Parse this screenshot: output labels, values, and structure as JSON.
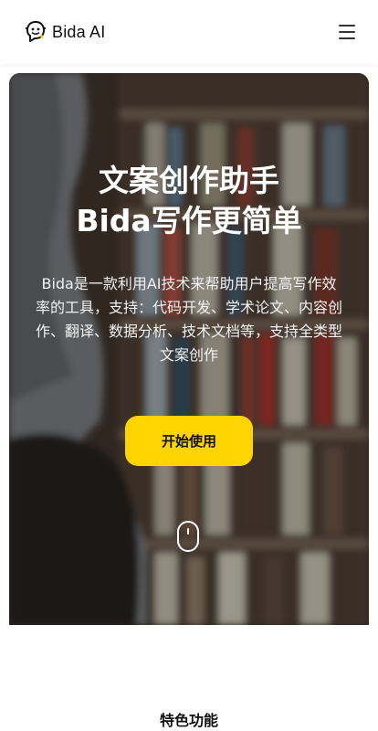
{
  "header": {
    "brand": "Bida AI",
    "logo_icon": "robot-face-icon",
    "menu_icon": "hamburger-menu-icon"
  },
  "hero": {
    "title_line1": "文案创作助手",
    "title_line2": "Bida写作更简单",
    "description": "Bida是一款利用AI技术来帮助用户提高写作效率的工具，支持：代码开发、学术论文、内容创作、翻译、数据分析、技术文档等，支持全类型文案创作",
    "cta_label": "开始使用",
    "scroll_icon": "mouse-scroll-icon",
    "accent_color": "#ffd400"
  },
  "features": {
    "title": "特色功能"
  }
}
